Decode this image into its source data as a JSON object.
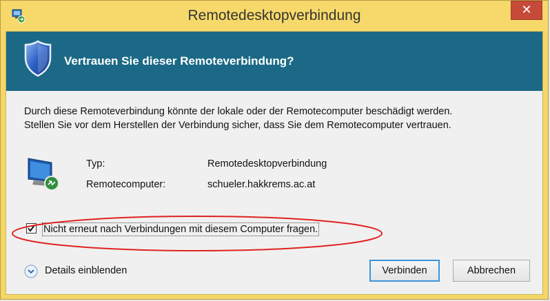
{
  "window": {
    "title": "Remotedesktopverbindung",
    "close_glyph": "✕",
    "app_icon": "remote-desktop-icon"
  },
  "banner": {
    "heading": "Vertrauen Sie dieser Remoteverbindung?",
    "icon": "shield-icon",
    "color": "#1b6986"
  },
  "warning": {
    "line1": "Durch diese Remoteverbindung könnte der lokale oder der Remotecomputer beschädigt werden.",
    "line2": "Stellen Sie vor dem Herstellen der Verbindung sicher, dass Sie dem Remotecomputer vertrauen."
  },
  "info": {
    "icon": "computer-connection-icon",
    "type_label": "Typ:",
    "type_value": "Remotedesktopverbindung",
    "remote_label": "Remotecomputer:",
    "remote_value": "schueler.hakkrems.ac.at"
  },
  "checkbox": {
    "checked": true,
    "label": "Nicht erneut nach Verbindungen mit diesem Computer fragen."
  },
  "details": {
    "label": "Details einblenden",
    "icon": "chevron-down-circle-icon"
  },
  "buttons": {
    "connect": "Verbinden",
    "cancel": "Abbrechen"
  },
  "colors": {
    "titlebar": "#f6d96a",
    "close": "#c54a3a",
    "highlight_annotation": "#e02020"
  }
}
